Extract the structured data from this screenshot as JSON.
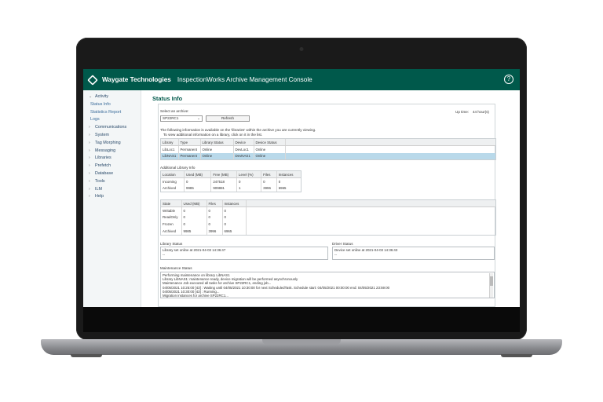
{
  "header": {
    "brand": "Waygate Technologies",
    "title": "InspectionWorks Archive Management Console",
    "help": "?"
  },
  "sidebar": {
    "items": [
      {
        "label": "Activity",
        "arrow": "⌄"
      },
      {
        "label": "Status Info",
        "sub": true
      },
      {
        "label": "Statistics Report",
        "sub": true
      },
      {
        "label": "Logs",
        "sub": true
      },
      {
        "label": "Communications",
        "arrow": "›"
      },
      {
        "label": "System",
        "arrow": "›"
      },
      {
        "label": "Tag Morphing",
        "arrow": "›"
      },
      {
        "label": "Messaging",
        "arrow": "›"
      },
      {
        "label": "Libraries",
        "arrow": "›"
      },
      {
        "label": "Prefetch",
        "arrow": "›"
      },
      {
        "label": "Database",
        "arrow": "›"
      },
      {
        "label": "Tools",
        "arrow": "›"
      },
      {
        "label": "ILM",
        "arrow": "›"
      },
      {
        "label": "Help",
        "arrow": "›"
      }
    ]
  },
  "main": {
    "title": "Status Info",
    "select_label": "Select an archive:",
    "archive_value": "SP22RC1",
    "refresh_label": "Refresh",
    "uptime_label": "Up time:",
    "uptime_value": "44 hour(s)",
    "info_line1": "The following information is available on the 'libraries' within the archive you are currently viewing.",
    "info_line2": "To view additional information on a library, click on it in the list.",
    "libraries": {
      "headers": [
        "Library",
        "Type",
        "Library Status",
        "Device",
        "Device Status"
      ],
      "rows": [
        [
          "LibLoc1",
          "Permanent",
          "Online",
          "DevLoc1",
          "Online"
        ],
        [
          "LibNAS1",
          "Permanent",
          "Online",
          "DevNAS1",
          "Online"
        ]
      ]
    },
    "additional_title": "Additional Library Info",
    "additional": {
      "headers": [
        "Location",
        "Used (MB)",
        "Free (MB)",
        "Level (%)",
        "Files",
        "Instances"
      ],
      "rows": [
        [
          "Incoming",
          "0",
          "247518",
          "0",
          "0",
          "0"
        ],
        [
          "Archived",
          "9985",
          "909881",
          "1",
          "3996",
          "6965"
        ]
      ]
    },
    "states": {
      "headers": [
        "State",
        "Used (MB)",
        "Files",
        "Instances"
      ],
      "rows": [
        [
          "Writable",
          "0",
          "0",
          "0"
        ],
        [
          "ReadOnly",
          "0",
          "0",
          "0"
        ],
        [
          "Frozen",
          "0",
          "0",
          "0"
        ],
        [
          "Archived",
          "9985",
          "3996",
          "6965"
        ]
      ]
    },
    "library_status_label": "Library Status",
    "library_status_text": "Library set online at 2021-04-03 14:36:47",
    "library_status_more": "--",
    "driver_status_label": "Driver Status",
    "driver_status_text": "Device set online at 2021-04-03 14:36:43",
    "driver_status_more": "--",
    "maintenance_label": "Maintenance Status",
    "maintenance_lines": [
      "Performing maintenance on library LibNAS1",
      "Library LibNAS1: maintenance ready, device migration will be performed asynchronously",
      "Maintenance Job executed all tasks for archive SP22RC1, ending job...",
      "04/05/2021 10:25:00 [43] : Waiting until 04/05/2021 10:30:00 for next ScheduledTask. Schedule start: 04/05/2021 00:00:00 end: 04/05/2021 23:59:00",
      "04/05/2021 10:30:00 [43] : Running...",
      "Migration instances for archive SP22RC1..."
    ]
  }
}
